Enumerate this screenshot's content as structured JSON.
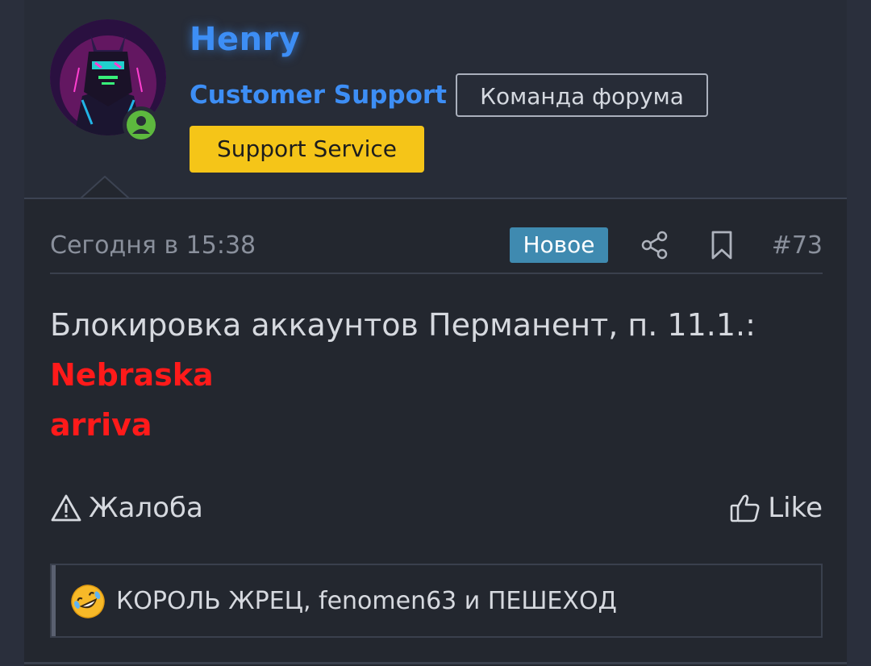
{
  "user": {
    "name": "Henry",
    "title": "Customer Support",
    "team_badge": "Команда форума",
    "role_badge": "Support Service",
    "online": true,
    "name_color": "#3d8ef5",
    "role_badge_color": "#f5c518"
  },
  "post": {
    "date": "Сегодня в 15:38",
    "new_badge": "Новое",
    "number": "#73",
    "content": {
      "line1": "Блокировка аккаунтов Перманент, п. 11.1.:",
      "names": [
        "Nebraska",
        "arriva"
      ]
    },
    "actions": {
      "report_label": "Жалоба",
      "like_label": "Like"
    },
    "reactions": {
      "text": "КОРОЛЬ ЖРЕЦ, fenomen63 и ПЕШЕХОД",
      "emoji": "rolling-on-floor-laughing"
    }
  },
  "colors": {
    "highlight_red": "#ff1a1a",
    "new_badge": "#3f8ab0",
    "online_green": "#5db83e"
  },
  "icons": [
    "share-icon",
    "bookmark-icon",
    "warning-icon",
    "thumbs-up-icon",
    "online-user-icon"
  ]
}
